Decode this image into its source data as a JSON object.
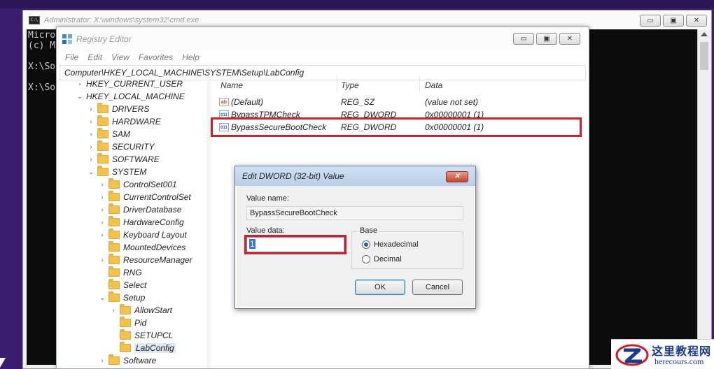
{
  "cmd": {
    "title": "Administrator: X:\\windows\\system32\\cmd.exe",
    "lines": [
      "Micro",
      "(c) M",
      "",
      "X:\\So",
      "",
      "X:\\So"
    ]
  },
  "regedit": {
    "title": "Registry Editor",
    "menu": [
      "File",
      "Edit",
      "View",
      "Favorites",
      "Help"
    ],
    "address": "Computer\\HKEY_LOCAL_MACHINE\\SYSTEM\\Setup\\LabConfig",
    "tree": [
      {
        "label": "HKEY_CURRENT_USER",
        "chev": "›",
        "folder": false
      },
      {
        "label": "HKEY_LOCAL_MACHINE",
        "chev": "⌄",
        "folder": false
      },
      {
        "label": "DRIVERS",
        "chev": "›",
        "folder": true
      },
      {
        "label": "HARDWARE",
        "chev": "›",
        "folder": true
      },
      {
        "label": "SAM",
        "chev": "›",
        "folder": true
      },
      {
        "label": "SECURITY",
        "chev": "›",
        "folder": true
      },
      {
        "label": "SOFTWARE",
        "chev": "›",
        "folder": true
      },
      {
        "label": "SYSTEM",
        "chev": "⌄",
        "folder": true
      },
      {
        "label": "ControlSet001",
        "chev": "›",
        "folder": true
      },
      {
        "label": "CurrentControlSet",
        "chev": "›",
        "folder": true
      },
      {
        "label": "DriverDatabase",
        "chev": "›",
        "folder": true
      },
      {
        "label": "HardwareConfig",
        "chev": "›",
        "folder": true
      },
      {
        "label": "Keyboard Layout",
        "chev": "›",
        "folder": true
      },
      {
        "label": "MountedDevices",
        "chev": "",
        "folder": true
      },
      {
        "label": "ResourceManager",
        "chev": "›",
        "folder": true
      },
      {
        "label": "RNG",
        "chev": "",
        "folder": true
      },
      {
        "label": "Select",
        "chev": "",
        "folder": true
      },
      {
        "label": "Setup",
        "chev": "⌄",
        "folder": true
      },
      {
        "label": "AllowStart",
        "chev": "›",
        "folder": true
      },
      {
        "label": "Pid",
        "chev": "",
        "folder": true
      },
      {
        "label": "SETUPCL",
        "chev": "",
        "folder": true
      },
      {
        "label": "LabConfig",
        "chev": "",
        "folder": true,
        "selected": true
      },
      {
        "label": "Software",
        "chev": "›",
        "folder": true
      }
    ],
    "columns": {
      "name": "Name",
      "type": "Type",
      "data": "Data"
    },
    "values": [
      {
        "name": "(Default)",
        "type": "REG_SZ",
        "data": "(value not set)",
        "icon": "ab"
      },
      {
        "name": "BypassTPMCheck",
        "type": "REG_DWORD",
        "data": "0x00000001 (1)",
        "icon": "011"
      },
      {
        "name": "BypassSecureBootCheck",
        "type": "REG_DWORD",
        "data": "0x00000001 (1)",
        "icon": "011"
      }
    ]
  },
  "dialog": {
    "title": "Edit DWORD (32-bit) Value",
    "close_label": "✕",
    "value_name_label": "Value name:",
    "value_name": "BypassSecureBootCheck",
    "value_data_label": "Value data:",
    "value_data": "1",
    "base_label": "Base",
    "radio_hex": "Hexadecimal",
    "radio_dec": "Decimal",
    "ok": "OK",
    "cancel": "Cancel"
  },
  "watermark": {
    "title": "这里教程网",
    "url": "herecours.com"
  },
  "colors": {
    "highlight": "#c9202a",
    "selection": "#3375d7"
  }
}
